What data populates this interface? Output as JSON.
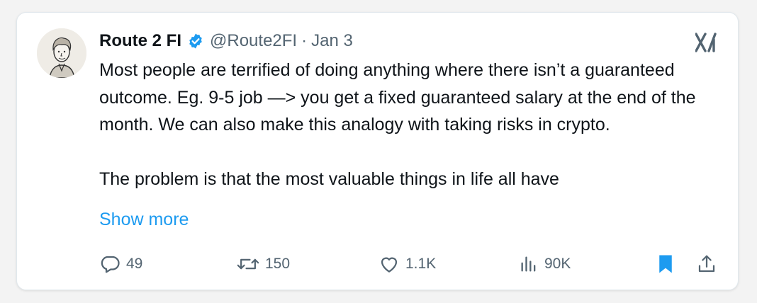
{
  "tweet": {
    "author_name": "Route 2 FI",
    "handle": "@Route2FI",
    "separator": "·",
    "date": "Jan 3",
    "paragraphs": [
      "Most people are terrified of doing anything where there isn’t a guaranteed outcome.  Eg. 9-5 job —> you get a fixed guaranteed salary at the end of the month. We can also make this analogy with taking risks in crypto.",
      "The problem is that the most valuable things in life all have"
    ],
    "show_more": "Show more"
  },
  "metrics": {
    "replies": "49",
    "reposts": "150",
    "likes": "1.1K",
    "views": "90K"
  },
  "icons": {
    "verified": "verified-badge-icon",
    "platform": "x-logo-icon",
    "reply": "reply-icon",
    "repost": "repost-icon",
    "like": "heart-icon",
    "views": "views-icon",
    "bookmark": "bookmark-icon",
    "share": "share-icon"
  },
  "colors": {
    "link": "#1d9bf0",
    "muted": "#536471",
    "text": "#0f1419",
    "bookmark_active": "#1d9bf0"
  }
}
